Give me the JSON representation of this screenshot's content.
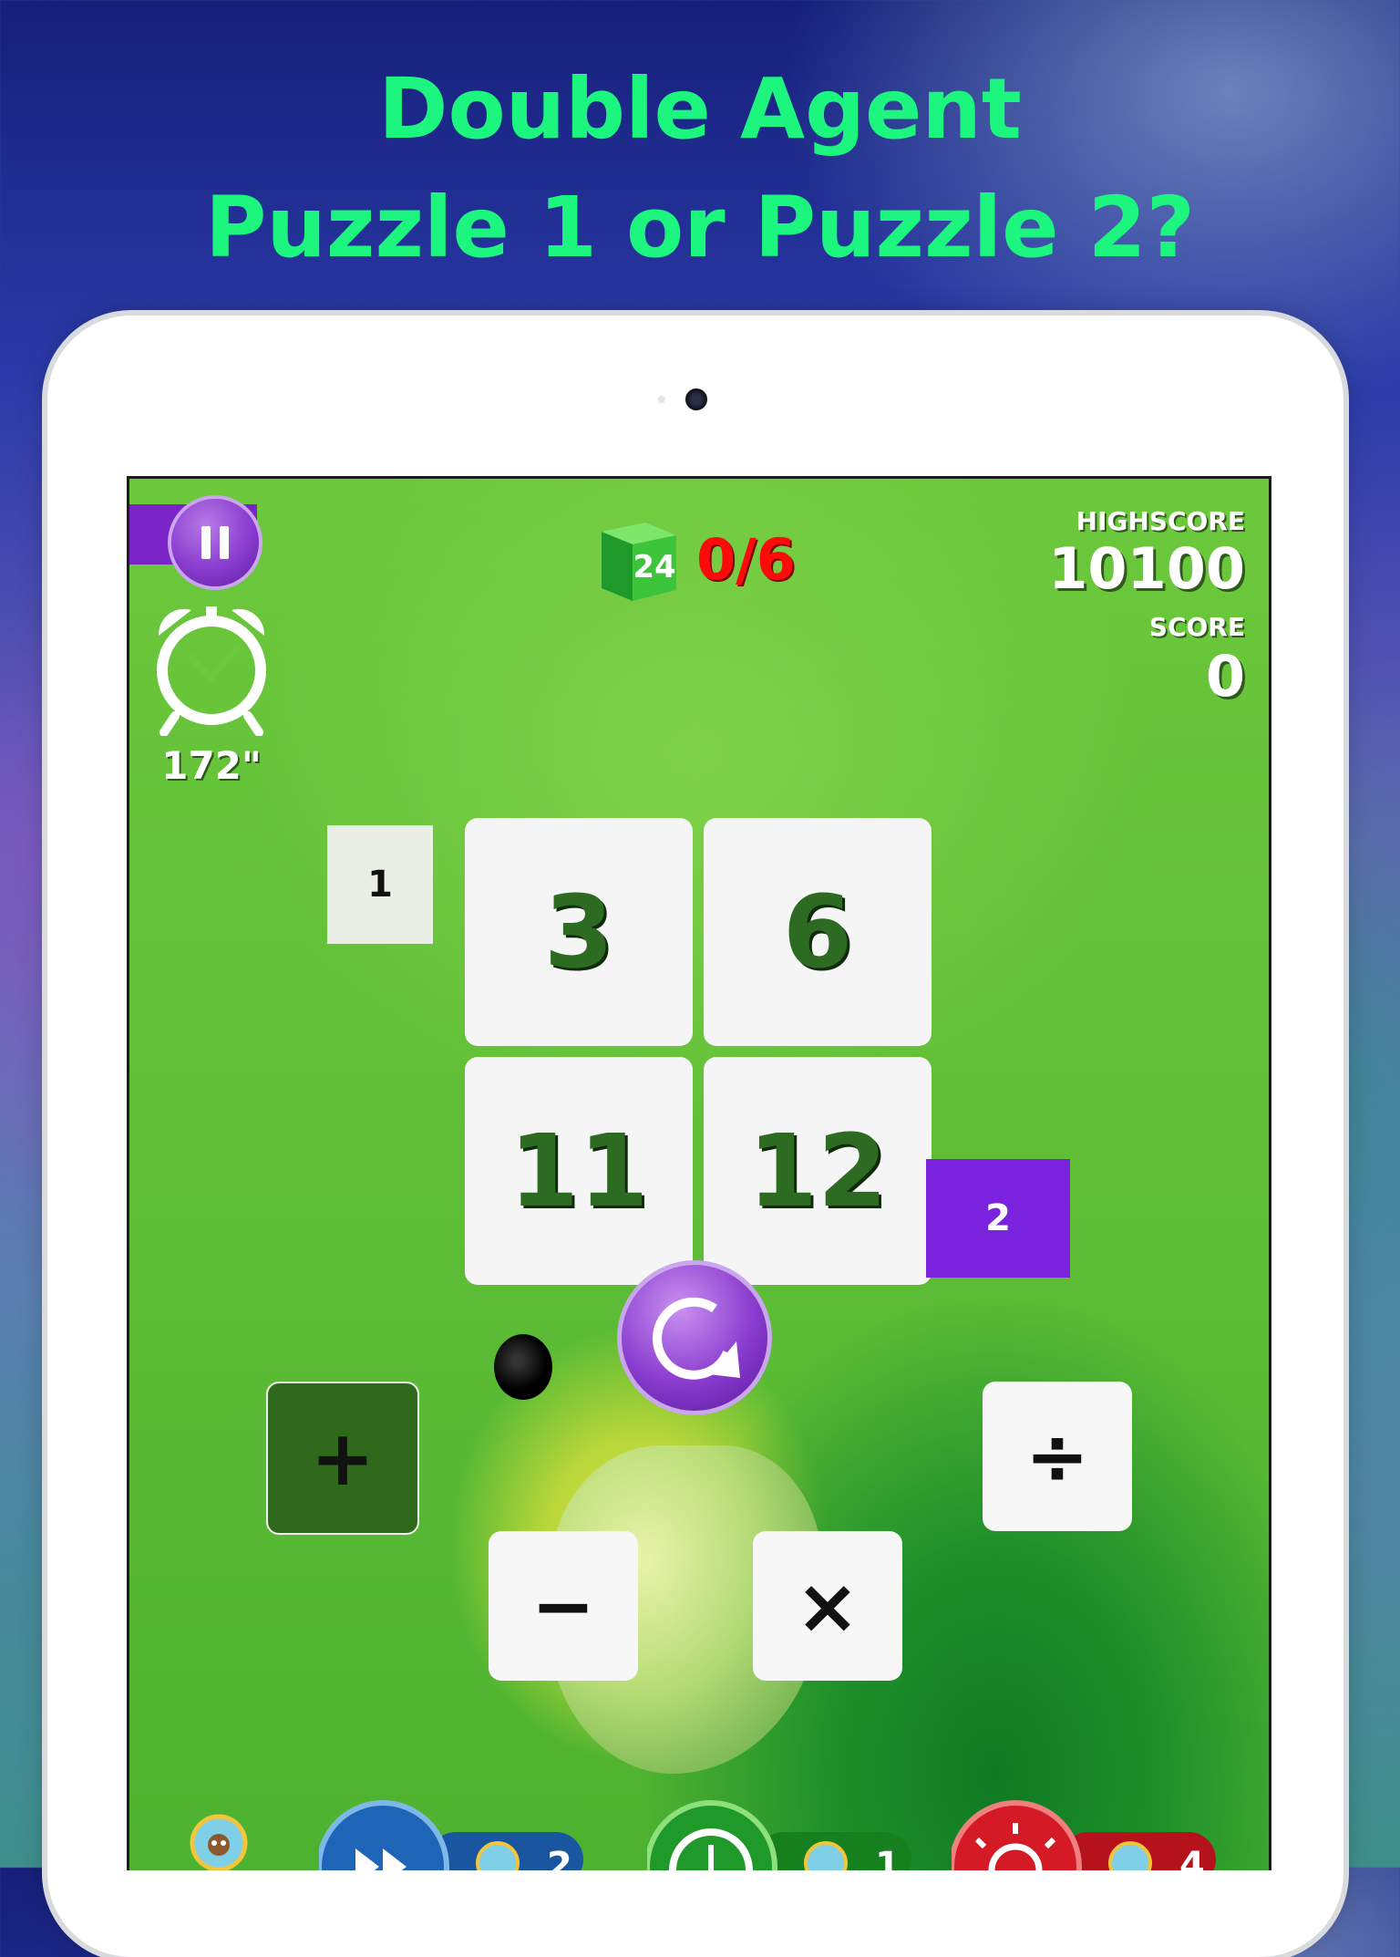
{
  "headline": {
    "line1": "Double Agent",
    "line2": "Puzzle 1 or Puzzle 2?",
    "color": "#1cf57e"
  },
  "game": {
    "logo_number": "24",
    "progress": "0/6",
    "highscore_label": "HIGHSCORE",
    "highscore_value": "10100",
    "score_label": "SCORE",
    "score_value": "0",
    "timer": "172\"",
    "cards": [
      "3",
      "6",
      "11",
      "12"
    ],
    "puzzle_markers": [
      "1",
      "2"
    ],
    "operators": {
      "plus": "+",
      "minus": "−",
      "times": "×",
      "divide": "÷"
    },
    "bottom_counts": [
      "2",
      "1",
      "4"
    ],
    "colors": {
      "accent_purple": "#7b24c8",
      "progress_red": "#ff0a0a",
      "card_text": "#2e6b22",
      "selected_operator": "#2f6a1c"
    }
  }
}
